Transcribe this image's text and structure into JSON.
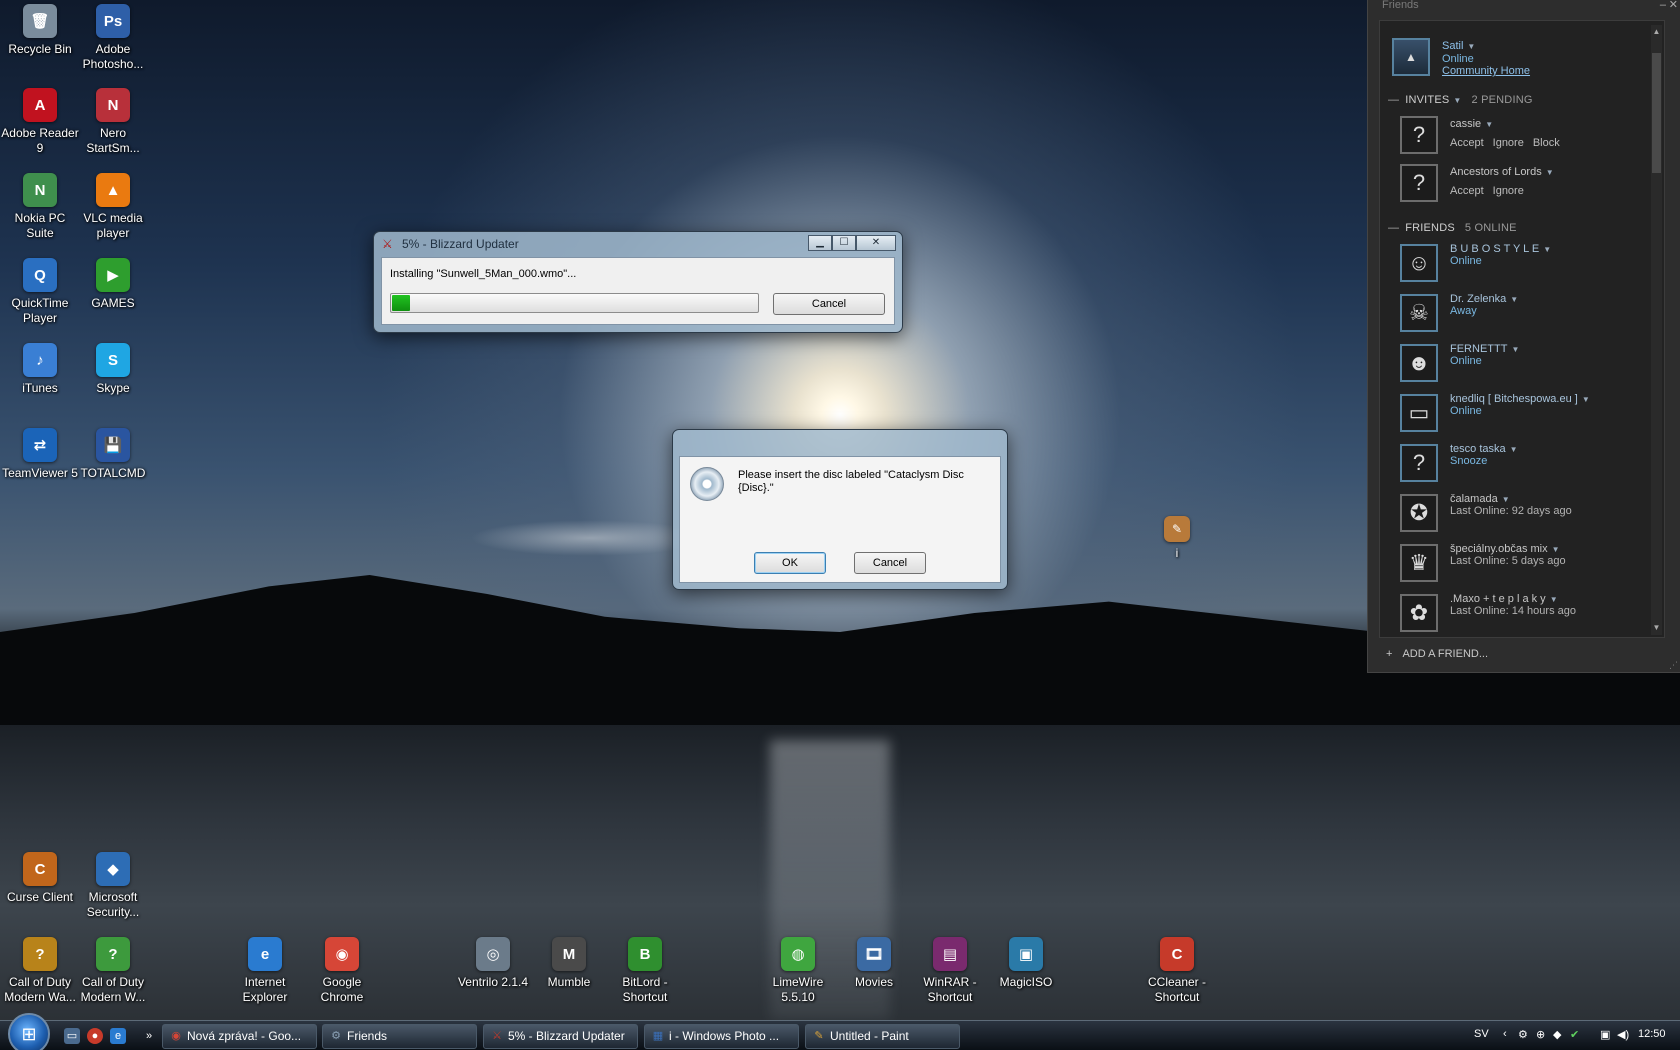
{
  "desktop_icons": [
    {
      "label": "Recycle Bin",
      "icon": "recycle-bin-icon",
      "glyph": "🗑",
      "color": "#7a8c9c"
    },
    {
      "label": "Adobe Photosho...",
      "icon": "photoshop-icon",
      "glyph": "Ps",
      "color": "#2e5fa8"
    },
    {
      "label": "Adobe Reader 9",
      "icon": "adobe-reader-icon",
      "glyph": "A",
      "color": "#c1121f"
    },
    {
      "label": "Nero StartSm...",
      "icon": "nero-icon",
      "glyph": "N",
      "color": "#b8303a"
    },
    {
      "label": "Nokia PC Suite",
      "icon": "nokia-icon",
      "glyph": "N",
      "color": "#3f8f4d"
    },
    {
      "label": "VLC media player",
      "icon": "vlc-icon",
      "glyph": "▲",
      "color": "#ea7a10"
    },
    {
      "label": "QuickTime Player",
      "icon": "quicktime-icon",
      "glyph": "Q",
      "color": "#2a6fc1"
    },
    {
      "label": "GAMES",
      "icon": "games-icon",
      "glyph": "▶",
      "color": "#2e9e2e"
    },
    {
      "label": "iTunes",
      "icon": "itunes-icon",
      "glyph": "♪",
      "color": "#3a7fd4"
    },
    {
      "label": "Skype",
      "icon": "skype-icon",
      "glyph": "S",
      "color": "#1fa6e3"
    },
    {
      "label": "TeamViewer 5",
      "icon": "teamviewer-icon",
      "glyph": "⇄",
      "color": "#1b64b8"
    },
    {
      "label": "TOTALCMD",
      "icon": "totalcmd-icon",
      "glyph": "💾",
      "color": "#2a55a0"
    },
    {
      "label": "Curse Client",
      "icon": "curse-client-icon",
      "glyph": "C",
      "color": "#c1661b"
    },
    {
      "label": "Microsoft Security...",
      "icon": "security-icon",
      "glyph": "◆",
      "color": "#2d6db5"
    },
    {
      "label": "Call of Duty Modern Wa...",
      "icon": "cod-icon",
      "glyph": "?",
      "color": "#b8831a"
    },
    {
      "label": "Call of Duty Modern W...",
      "icon": "cod2-icon",
      "glyph": "?",
      "color": "#3d9a3d"
    },
    {
      "label": "Internet Explorer",
      "icon": "ie-icon",
      "glyph": "e",
      "color": "#2a7bd0"
    },
    {
      "label": "Google Chrome",
      "icon": "chrome-icon",
      "glyph": "◉",
      "color": "#d64637"
    },
    {
      "label": "Ventrilo 2.1.4",
      "icon": "ventrilo-icon",
      "glyph": "◎",
      "color": "#6b7b8a"
    },
    {
      "label": "Mumble",
      "icon": "mumble-icon",
      "glyph": "M",
      "color": "#4a4a4a"
    },
    {
      "label": "BitLord - Shortcut",
      "icon": "bitlord-icon",
      "glyph": "B",
      "color": "#2f8f2f"
    },
    {
      "label": "LimeWire 5.5.10",
      "icon": "limewire-icon",
      "glyph": "◍",
      "color": "#3fa63f"
    },
    {
      "label": "Movies",
      "icon": "movies-icon",
      "glyph": "🎞",
      "color": "#3b6aa3"
    },
    {
      "label": "WinRAR - Shortcut",
      "icon": "winrar-icon",
      "glyph": "▤",
      "color": "#7a2a6e"
    },
    {
      "label": "MagicISO",
      "icon": "magiciso-icon",
      "glyph": "▣",
      "color": "#2a7aa8"
    },
    {
      "label": "CCleaner - Shortcut",
      "icon": "ccleaner-icon",
      "glyph": "C",
      "color": "#c63a2a"
    },
    {
      "label": "i",
      "icon": "image-file-icon",
      "glyph": "✎",
      "color": "#b87a3a"
    }
  ],
  "updater": {
    "title": "5% - Blizzard Updater",
    "status": "Installing \"Sunwell_5Man_000.wmo\"...",
    "progress": 0.05,
    "cancel_label": "Cancel",
    "accent": "#22c322"
  },
  "disc_dialog": {
    "message": "Please insert the disc labeled \"Cataclysm Disc {Disc}.\"",
    "ok_label": "OK",
    "cancel_label": "Cancel"
  },
  "friends": {
    "title": "Friends",
    "me": {
      "name": "Satil",
      "status": "Online",
      "link": "Community Home"
    },
    "invites": {
      "title": "INVITES",
      "count": "2 PENDING",
      "items": [
        {
          "name": "cassie",
          "actions": [
            "Accept",
            "Ignore",
            "Block"
          ]
        },
        {
          "name": "Ancestors of Lords",
          "actions": [
            "Accept",
            "Ignore"
          ]
        }
      ]
    },
    "friends_section": {
      "title": "FRIENDS",
      "count": "5 ONLINE",
      "items": [
        {
          "name": "B U B O S T Y L E",
          "status": "Online",
          "kind": "online",
          "avatar": "☺"
        },
        {
          "name": "Dr. Zelenka",
          "status": "Away",
          "kind": "online",
          "avatar": "☠"
        },
        {
          "name": "FERNETTT",
          "status": "Online",
          "kind": "online",
          "avatar": "☻"
        },
        {
          "name": "knedliq [ Bitchespowa.eu ]",
          "status": "Online",
          "kind": "online",
          "avatar": "▭"
        },
        {
          "name": "tesco taska",
          "status": "Snooze",
          "kind": "online",
          "avatar": "?"
        },
        {
          "name": "čalamada",
          "status": "Last Online: 92 days ago",
          "kind": "offline",
          "avatar": "✪"
        },
        {
          "name": "špeciálny.občas mix",
          "status": "Last Online: 5 days ago",
          "kind": "offline",
          "avatar": "♛"
        },
        {
          "name": ".Maxo + t e p l a k y",
          "status": "Last Online: 14 hours ago",
          "kind": "offline",
          "avatar": "✿"
        }
      ]
    },
    "add_friend": "ADD A FRIEND..."
  },
  "taskbar": {
    "tasks": [
      {
        "label": "Nová zpráva! - Goo...",
        "icon": "chrome-icon",
        "glyph": "◉",
        "color": "#d64637"
      },
      {
        "label": "Friends",
        "icon": "steam-icon",
        "glyph": "⚙",
        "color": "#8aa0b4"
      },
      {
        "label": "5% - Blizzard Updater",
        "icon": "blizzard-icon",
        "glyph": "⚔",
        "color": "#c0392b"
      },
      {
        "label": "i - Windows Photo ...",
        "icon": "photo-viewer-icon",
        "glyph": "▦",
        "color": "#3a6fb8"
      },
      {
        "label": "Untitled - Paint",
        "icon": "paint-icon",
        "glyph": "✎",
        "color": "#d8a23a"
      }
    ],
    "language": "SV",
    "clock": "12:50"
  }
}
